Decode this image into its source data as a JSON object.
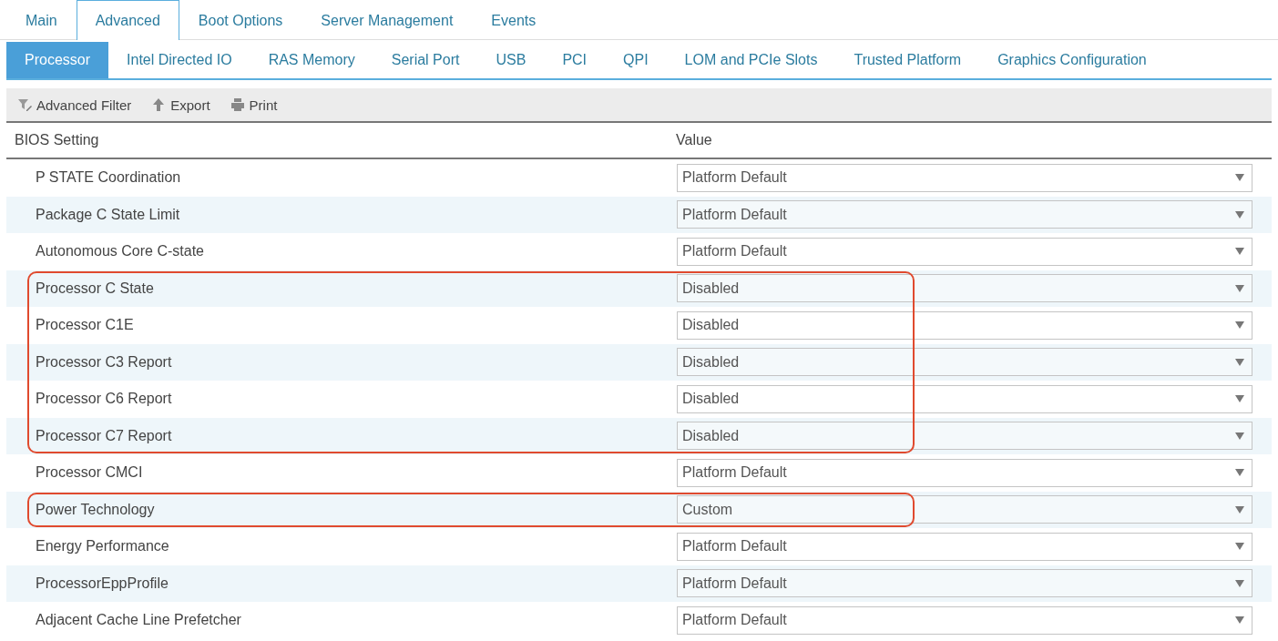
{
  "top_tabs": [
    {
      "label": "Main",
      "selected": false
    },
    {
      "label": "Advanced",
      "selected": true
    },
    {
      "label": "Boot Options",
      "selected": false
    },
    {
      "label": "Server Management",
      "selected": false
    },
    {
      "label": "Events",
      "selected": false
    }
  ],
  "sub_tabs": [
    {
      "label": "Processor",
      "selected": true
    },
    {
      "label": "Intel Directed IO",
      "selected": false
    },
    {
      "label": "RAS Memory",
      "selected": false
    },
    {
      "label": "Serial Port",
      "selected": false
    },
    {
      "label": "USB",
      "selected": false
    },
    {
      "label": "PCI",
      "selected": false
    },
    {
      "label": "QPI",
      "selected": false
    },
    {
      "label": "LOM and PCIe Slots",
      "selected": false
    },
    {
      "label": "Trusted Platform",
      "selected": false
    },
    {
      "label": "Graphics Configuration",
      "selected": false
    }
  ],
  "toolbar": [
    {
      "label": "Advanced Filter",
      "kind": "filter"
    },
    {
      "label": "Export",
      "kind": "export"
    },
    {
      "label": "Print",
      "kind": "print"
    }
  ],
  "table": {
    "columns": [
      "BIOS Setting",
      "Value"
    ],
    "rows": [
      {
        "setting": "P STATE Coordination",
        "value": "Platform Default",
        "highlighted": false
      },
      {
        "setting": "Package C State Limit",
        "value": "Platform Default",
        "highlighted": false
      },
      {
        "setting": "Autonomous Core C-state",
        "value": "Platform Default",
        "highlighted": false
      },
      {
        "setting": "Processor C State",
        "value": "Disabled",
        "highlighted": true
      },
      {
        "setting": "Processor C1E",
        "value": "Disabled",
        "highlighted": true
      },
      {
        "setting": "Processor C3 Report",
        "value": "Disabled",
        "highlighted": true
      },
      {
        "setting": "Processor C6 Report",
        "value": "Disabled",
        "highlighted": true
      },
      {
        "setting": "Processor C7 Report",
        "value": "Disabled",
        "highlighted": true
      },
      {
        "setting": "Processor CMCI",
        "value": "Platform Default",
        "highlighted": false
      },
      {
        "setting": "Power Technology",
        "value": "Custom",
        "highlighted": true
      },
      {
        "setting": "Energy Performance",
        "value": "Platform Default",
        "highlighted": false
      },
      {
        "setting": "ProcessorEppProfile",
        "value": "Platform Default",
        "highlighted": false
      },
      {
        "setting": "Adjacent Cache Line Prefetcher",
        "value": "Platform Default",
        "highlighted": false
      }
    ]
  }
}
